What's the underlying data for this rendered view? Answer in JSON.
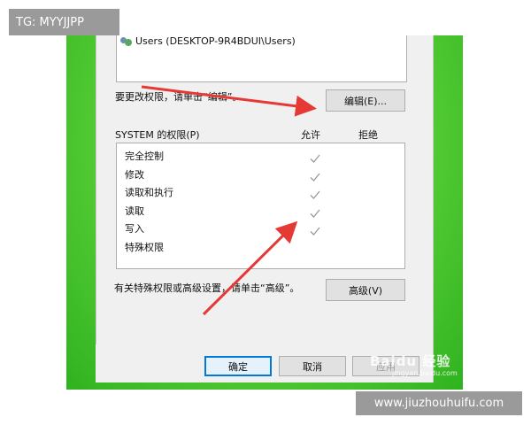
{
  "tag": "TG: MYYJJPP",
  "url_label": "www.jiuzhouhuifu.com",
  "users_entry": "Users (DESKTOP-9R4BDUI\\Users)",
  "edit_hint": "要更改权限，请单击“编辑”。",
  "edit_button": "编辑(E)...",
  "permissions_header": "SYSTEM 的权限(P)",
  "allow_header": "允许",
  "deny_header": "拒绝",
  "permissions": [
    {
      "name": "完全控制",
      "allow": true
    },
    {
      "name": "修改",
      "allow": true
    },
    {
      "name": "读取和执行",
      "allow": true
    },
    {
      "name": "读取",
      "allow": true
    },
    {
      "name": "写入",
      "allow": true
    },
    {
      "name": "特殊权限",
      "allow": false
    }
  ],
  "advanced_hint": "有关特殊权限或高级设置，请单击“高级”。",
  "advanced_button": "高级(V)",
  "ok_button": "确定",
  "cancel_button": "取消",
  "apply_button": "应用",
  "watermark": "Baidu 经验",
  "watermark_sub": "jingyan.baidu.com",
  "colors": {
    "arrow": "#e53935",
    "background_green": "#3cc22a",
    "focus_border": "#0078d7"
  }
}
